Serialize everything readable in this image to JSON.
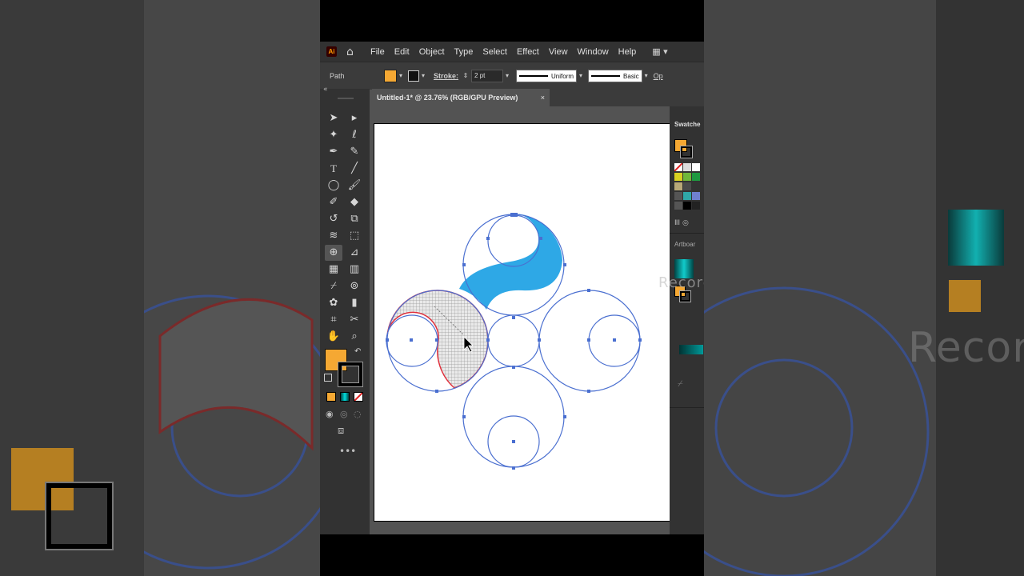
{
  "app": {
    "logo": "Ai",
    "menus": [
      "File",
      "Edit",
      "Object",
      "Type",
      "Select",
      "Effect",
      "View",
      "Window",
      "Help"
    ]
  },
  "control_bar": {
    "selection_label": "Path",
    "stroke_label": "Stroke:",
    "stroke_value": "2 pt",
    "profile_label": "Uniform",
    "brush_label": "Basic",
    "opacity_label": "Op"
  },
  "document_tab": {
    "title": "Untitled-1* @ 23.76% (RGB/GPU Preview)",
    "close": "×"
  },
  "panels": {
    "swatches_title": "Swatche",
    "artboards_title": "Artboar"
  },
  "overlay_text": "Record",
  "colors": {
    "fill": "#f5a833",
    "shape_blue": "#2ea8e6",
    "guide_blue": "#4a6fd0",
    "selection_red": "#e0303c"
  },
  "tools": [
    "selection-tool",
    "direct-selection-tool",
    "magic-wand-tool",
    "lasso-tool",
    "pen-tool",
    "curvature-tool",
    "type-tool",
    "line-tool",
    "ellipse-tool",
    "paintbrush-tool",
    "shaper-tool",
    "eraser-tool",
    "rotate-tool",
    "scale-tool",
    "warp-tool",
    "free-transform-tool",
    "shape-builder-tool",
    "perspective-tool",
    "mesh-tool",
    "gradient-tool",
    "eyedropper-tool",
    "blend-tool",
    "symbol-sprayer-tool",
    "graph-tool",
    "artboard-tool",
    "slice-tool",
    "hand-tool",
    "zoom-tool"
  ]
}
